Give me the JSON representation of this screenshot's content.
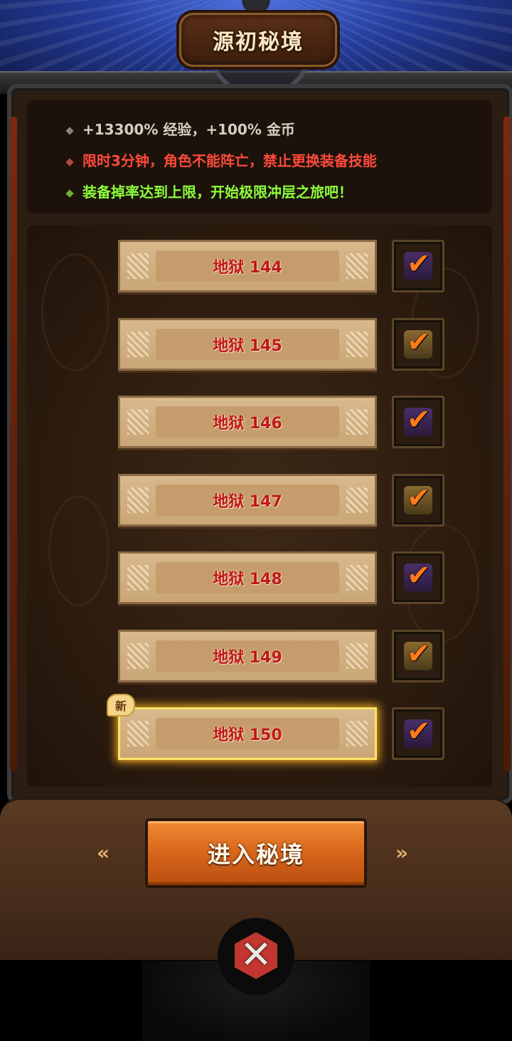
{
  "header": {
    "title": "源初秘境"
  },
  "info": {
    "line1": "+13300% 经验，+100% 金币",
    "line2": "限时3分钟，角色不能阵亡，禁止更换装备技能",
    "line3": "装备掉率达到上限，开始极限冲层之旅吧！"
  },
  "levels": [
    {
      "label": "地狱 144",
      "checked": true
    },
    {
      "label": "地狱 145",
      "checked": true
    },
    {
      "label": "地狱 146",
      "checked": true
    },
    {
      "label": "地狱 147",
      "checked": true
    },
    {
      "label": "地狱 148",
      "checked": true
    },
    {
      "label": "地狱 149",
      "checked": true
    },
    {
      "label": "地狱 150",
      "checked": true,
      "selected": true,
      "badge": "新"
    }
  ],
  "enter_button": {
    "label": "进入秘境"
  },
  "check_glyph": "✔",
  "close_glyph": "✕",
  "arrow_left": "«",
  "arrow_right": "»",
  "colors": {
    "info_red": "#ff4a3a",
    "info_green": "#8eff3c",
    "level_text": "#c01818",
    "button_orange": "#d7661b"
  }
}
